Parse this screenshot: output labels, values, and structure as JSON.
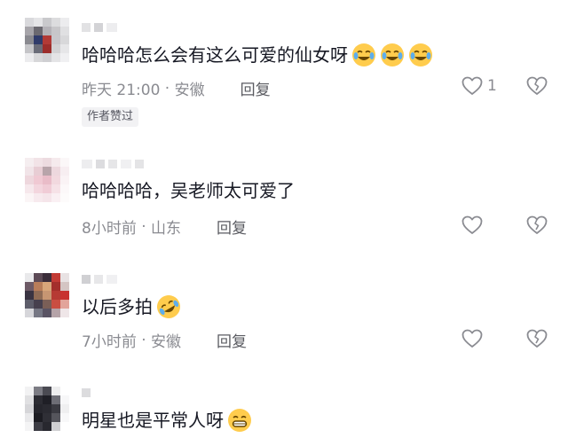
{
  "colors": {
    "text": "#161823",
    "meta": "#8a8b91",
    "icon": "#8a8b91",
    "emoji_face": "#ffcc4d"
  },
  "comments": [
    {
      "text": "哈哈哈怎么会有这么可爱的仙女呀",
      "emojis": [
        "laugh-cry-emoji",
        "laugh-cry-emoji",
        "laugh-cry-emoji"
      ],
      "time": "昨天 21:00",
      "location": "安徽",
      "reply": "回复",
      "badge": "作者赞过",
      "likes": "1"
    },
    {
      "text": "哈哈哈哈，吴老师太可爱了",
      "emojis": [],
      "time": "8小时前",
      "location": "山东",
      "reply": "回复",
      "badge": "",
      "likes": ""
    },
    {
      "text": "以后多拍",
      "emojis": [
        "rofl-emoji"
      ],
      "time": "7小时前",
      "location": "安徽",
      "reply": "回复",
      "badge": "",
      "likes": ""
    },
    {
      "text": "明星也是平常人呀",
      "emojis": [
        "grin-emoji"
      ],
      "time": "",
      "location": "",
      "reply": "",
      "badge": "",
      "likes": ""
    }
  ]
}
